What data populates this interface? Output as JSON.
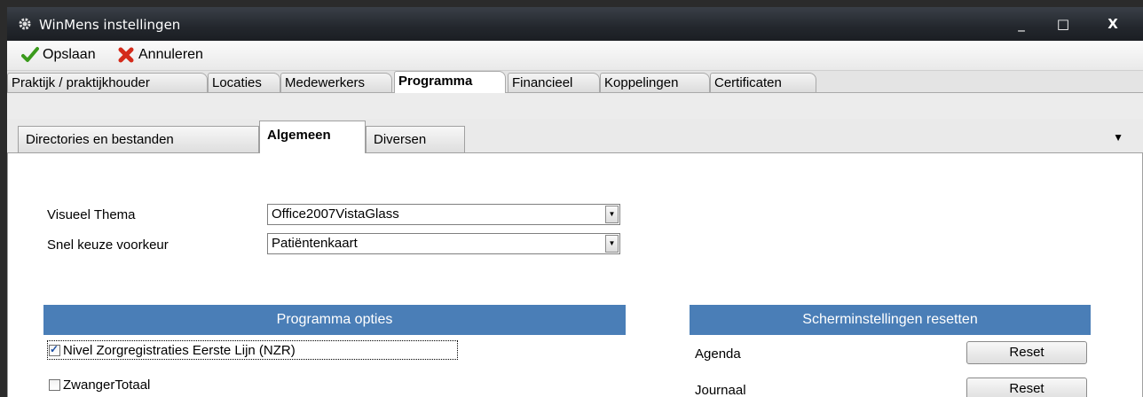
{
  "window": {
    "title": "WinMens instellingen",
    "controls": {
      "minimize": "_",
      "maximize": "□",
      "close": "X"
    }
  },
  "toolbar": {
    "save_label": "Opslaan",
    "cancel_label": "Annuleren"
  },
  "main_tabs": [
    "Praktijk / praktijkhouder",
    "Locaties",
    "Medewerkers",
    "Programma",
    "Financieel",
    "Koppelingen",
    "Certificaten"
  ],
  "sub_tabs": [
    "Directories en bestanden",
    "Algemeen",
    "Diversen"
  ],
  "form": {
    "theme_label": "Visueel Thema",
    "theme_value": "Office2007VistaGlass",
    "quick_label": "Snel keuze voorkeur",
    "quick_value": "Patiëntenkaart"
  },
  "program_options": {
    "header": "Programma opties",
    "items": [
      {
        "label": "Nivel Zorgregistraties Eerste Lijn (NZR)",
        "checked": true
      },
      {
        "label": "ZwangerTotaal",
        "checked": false
      }
    ]
  },
  "screen_reset": {
    "header": "Scherminstellingen resetten",
    "rows": [
      {
        "label": "Agenda",
        "button": "Reset"
      },
      {
        "label": "Journaal",
        "button": "Reset"
      }
    ]
  },
  "colors": {
    "section_header": "#4a7eb7",
    "titlebar": "#23272d"
  }
}
